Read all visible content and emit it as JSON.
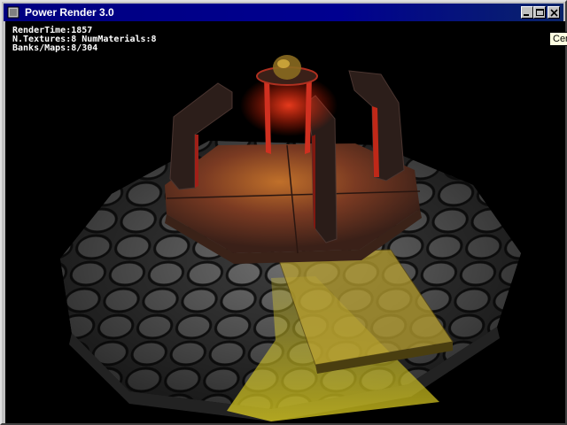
{
  "window": {
    "title": "Power Render 3.0"
  },
  "title_buttons": {
    "minimize": "minimize-icon",
    "maximize": "maximize-icon",
    "close": "close-icon"
  },
  "hud": {
    "render_time": "RenderTime:1857",
    "textures": "N.Textures:8 NumMaterials:8",
    "banks": "Banks/Maps:8/304"
  },
  "tooltip": {
    "text": "Cen"
  },
  "scene": {
    "description_icon": "3d-scene",
    "colors": {
      "floor": "#5a5a5a",
      "floor_dark": "#1a1a1a",
      "platform": "#8a4a2a",
      "glow": "#ff3020",
      "ramp": "#b8a030",
      "light": "#d8c820"
    }
  }
}
